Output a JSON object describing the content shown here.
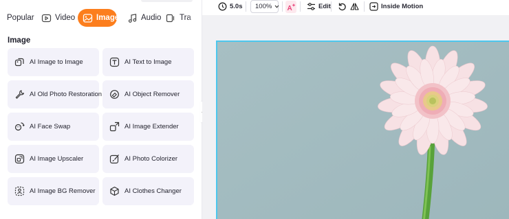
{
  "tabs": {
    "popular": "Popular",
    "video": "Video",
    "image": "Image",
    "audio": "Audio",
    "transitions": "Tra"
  },
  "section": {
    "title": "Image"
  },
  "tools": {
    "image_to_image": "AI Image to Image",
    "text_to_image": "AI Text to Image",
    "old_photo": "AI Old Photo Restoration",
    "object_remover": "AI Object Remover",
    "face_swap": "AI Face Swap",
    "image_extender": "AI Image Extender",
    "upscaler": "AI Image Upscaler",
    "photo_colorizer": "AI Photo Colorizer",
    "bg_remover": "AI Image BG Remover",
    "clothes_changer": "AI Clothes Changer"
  },
  "toolbar": {
    "duration": "5.0s",
    "zoom": "100%",
    "edit": "Edit",
    "inside_motion": "Inside Motion"
  },
  "colors": {
    "accent": "#fc7e1d",
    "card_bg": "#f3f2fa",
    "canvas_border": "#4cc7ee",
    "ai_badge": "#e8457a"
  }
}
